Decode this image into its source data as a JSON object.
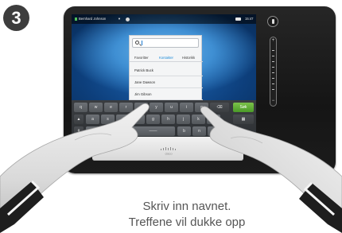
{
  "step_number": "3",
  "status_bar": {
    "user_name": "Bernhard Johnson",
    "caret": "▼",
    "clock": "15:47"
  },
  "search": {
    "value": "",
    "tabs": [
      {
        "label": "Favoritter",
        "active": false
      },
      {
        "label": "Kontakter",
        "active": true
      },
      {
        "label": "Historikk",
        "active": false
      }
    ],
    "results": [
      "Patrick Buck",
      "Jane Dawson",
      "Jim Gibson"
    ]
  },
  "keyboard": {
    "row1": [
      "q",
      "w",
      "e",
      "r",
      "t",
      "y",
      "u",
      "i",
      "o",
      "p"
    ],
    "row2": [
      "a",
      "s",
      "d",
      "f",
      "g",
      "h",
      "j",
      "k",
      "l"
    ],
    "row3": [
      "z",
      "x",
      "c",
      "v",
      "b",
      "n",
      "m"
    ],
    "search_key_label": "Søk",
    "space_label": "——"
  },
  "volume": {
    "plus": "+",
    "minus": "−"
  },
  "brand_logo": "cisco",
  "caption": {
    "line1": "Skriv inn navnet.",
    "line2": "Treffene vil dukke opp"
  },
  "colors": {
    "accent": "#1a8ad8",
    "search_key": "#5aab34",
    "badge": "#3d3d3d"
  }
}
